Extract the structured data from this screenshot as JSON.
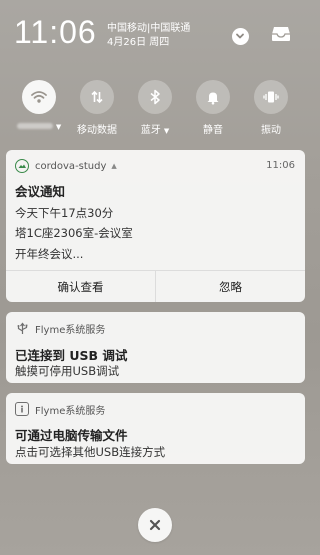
{
  "status": {
    "time": "11:06",
    "carriers": "中国移动|中国联通",
    "date": "4月26日 周四"
  },
  "header_icons": {
    "expand": "chevron-down-icon",
    "inbox": "inbox-tray-icon"
  },
  "toggles": [
    {
      "icon": "wifi-icon",
      "label": "",
      "active": true
    },
    {
      "icon": "mobile-data-icon",
      "label": "移动数据",
      "active": false
    },
    {
      "icon": "bluetooth-icon",
      "label": "蓝牙",
      "active": false
    },
    {
      "icon": "bell-icon",
      "label": "静音",
      "active": false
    },
    {
      "icon": "vibrate-icon",
      "label": "振动",
      "active": false
    }
  ],
  "notifications": [
    {
      "app": "cordova-study",
      "time": "11:06",
      "title": "会议通知",
      "lines": [
        "今天下午17点30分",
        "塔1C座2306室-会议室",
        "开年终会议..."
      ],
      "actions": [
        "确认查看",
        "忽略"
      ]
    },
    {
      "app": "Flyme系统服务",
      "title": "已连接到 USB 调试",
      "lines": [
        "触摸可停用USB调试"
      ]
    },
    {
      "app": "Flyme系统服务",
      "title": "可通过电脑传输文件",
      "lines": [
        "点击可选择其他USB连接方式"
      ]
    }
  ],
  "colors": {
    "accent_green": "#3a8a4a",
    "card_bg": "#f7f7f6"
  }
}
